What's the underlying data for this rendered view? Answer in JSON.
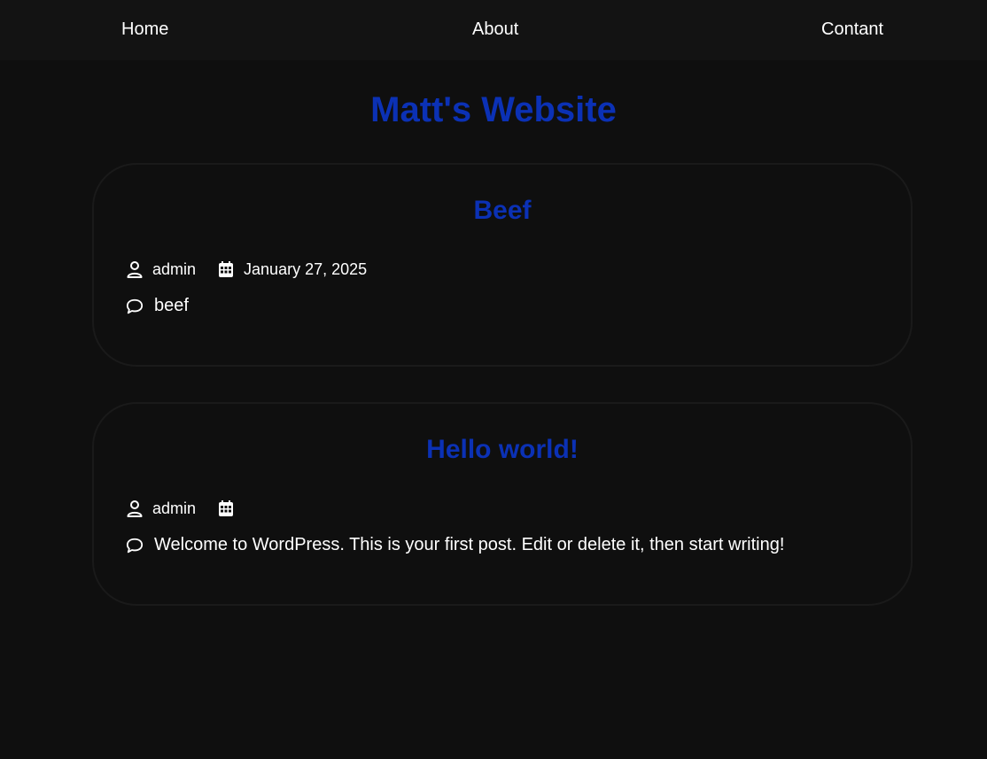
{
  "nav": {
    "home": "Home",
    "about": "About",
    "contact": "Contant"
  },
  "site": {
    "title": "Matt's Website"
  },
  "posts": [
    {
      "title": "Beef",
      "author": "admin",
      "date": "January 27, 2025",
      "excerpt": "beef"
    },
    {
      "title": "Hello world!",
      "author": "admin",
      "date": "",
      "excerpt": "Welcome to WordPress. This is your first post. Edit or delete it, then start writing!"
    }
  ],
  "colors": {
    "background": "#0f0f0f",
    "nav_background": "#131313",
    "accent": "#0b31b5",
    "text": "#ffffff"
  },
  "icons": {
    "author": "user-icon",
    "date": "calendar-icon",
    "excerpt": "comment-icon"
  }
}
